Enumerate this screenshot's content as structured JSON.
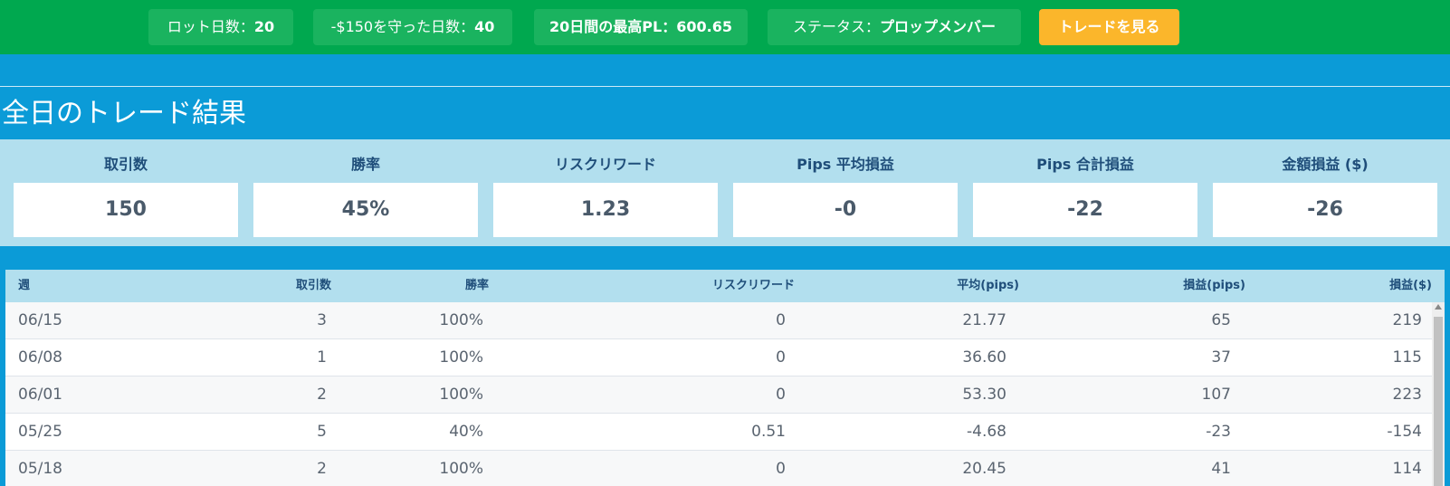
{
  "topbar": {
    "pills": [
      {
        "label": "ロット日数：",
        "value": "20"
      },
      {
        "label": "-$150を守った日数：",
        "value": "40"
      },
      {
        "label": "20日間の最高PL：",
        "value": "600.65"
      },
      {
        "label": "ステータス：",
        "value": "プロップメンバー"
      }
    ],
    "cta": "トレードを見る",
    "accent": "#fbb62b"
  },
  "section_title": "全日のトレード結果",
  "stats": [
    {
      "label": "取引数",
      "value": "150"
    },
    {
      "label": "勝率",
      "value": "45%"
    },
    {
      "label": "リスクリワード",
      "value": "1.23"
    },
    {
      "label": "Pips 平均損益",
      "value": "-0"
    },
    {
      "label": "Pips 合計損益",
      "value": "-22"
    },
    {
      "label": "金額損益 ($)",
      "value": "-26"
    }
  ],
  "table": {
    "headers": [
      "週",
      "取引数",
      "勝率",
      "リスクリワード",
      "平均(pips)",
      "損益(pips)",
      "損益($)"
    ],
    "rows": [
      [
        "06/15",
        "3",
        "100%",
        "0",
        "21.77",
        "65",
        "219"
      ],
      [
        "06/08",
        "1",
        "100%",
        "0",
        "36.60",
        "37",
        "115"
      ],
      [
        "06/01",
        "2",
        "100%",
        "0",
        "53.30",
        "107",
        "223"
      ],
      [
        "05/25",
        "5",
        "40%",
        "0.51",
        "-4.68",
        "-23",
        "-154"
      ],
      [
        "05/18",
        "2",
        "100%",
        "0",
        "20.45",
        "41",
        "114"
      ]
    ]
  }
}
